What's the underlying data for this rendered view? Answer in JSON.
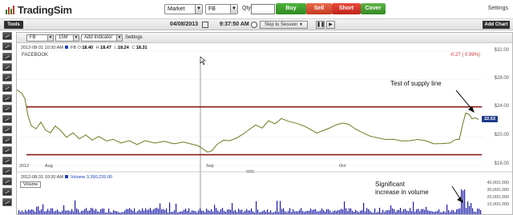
{
  "app": {
    "name": "TradingSim"
  },
  "toolbar": {
    "order_type": "Market",
    "symbol": "FB",
    "qty_label": "Qty:",
    "qty_value": "",
    "buy_label": "Buy",
    "sell_label": "Sell",
    "short_label": "Short",
    "cover_label": "Cover",
    "settings_label": "Settings"
  },
  "session_bar": {
    "tools_label": "Tools",
    "date": "04/08/2013",
    "time": "9:37:50 AM",
    "skip_label": "Skip to Session",
    "add_chart_label": "Add Chart"
  },
  "chart_toolbar": {
    "symbol": "FB",
    "interval": "15M",
    "add_indicator_label": "Add Indicator",
    "settings_label": "Settings"
  },
  "ohlc": {
    "timestamp": "2012-08-31 10:30 AM",
    "symbol": "FB",
    "o_label": "O:",
    "o": "18.40",
    "h_label": "H:",
    "h": "18.47",
    "l_label": "L:",
    "l": "18.24",
    "c_label": "C:",
    "c": "18.31"
  },
  "ticker_name": "FACEBOOK",
  "change_text": "-0.27 ( 0.99%)",
  "price_axis": [
    "$32.00",
    "$28.00",
    "$24.00",
    "$20.00",
    "$16.00"
  ],
  "last_price": "22.53",
  "date_axis": [
    "2012",
    "Aug",
    "Sep",
    "Oct"
  ],
  "annotations": {
    "supply": "Test of supply line",
    "volume_line1": "Significant",
    "volume_line2": "increase in volume"
  },
  "volume_panel": {
    "info_timestamp": "2012-08-31 10:30 AM",
    "info_label": "Volume",
    "info_value": "3,390,226.00",
    "button_label": "Volume",
    "axis": [
      "40,000,000",
      "30,000,000",
      "20,000,000",
      "10,000,000"
    ]
  },
  "colors": {
    "price_line": "#6b7a1e",
    "support_resistance": "#8b1a1a",
    "volume": "#1a1aa8",
    "buy": "#3c9a2c",
    "sell": "#d64b2f",
    "short": "#d8352a",
    "cover": "#4c9d35"
  }
}
